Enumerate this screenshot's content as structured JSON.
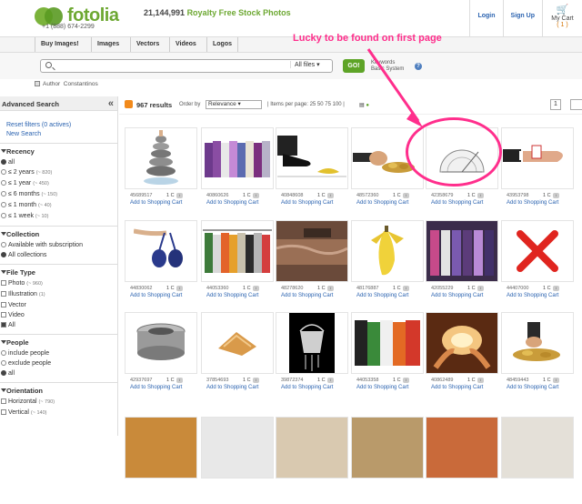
{
  "brand": {
    "name": "fotolia",
    "phone": "+1 (888) 674-2299",
    "stock_count": "21,144,991",
    "tagline": "Royalty Free Stock Photos"
  },
  "top_links": {
    "login": "Login",
    "signup": "Sign Up",
    "cart_label": "My Cart",
    "cart_count": "( 1 )"
  },
  "nav": [
    "Buy Images!",
    "Images",
    "Vectors",
    "Videos",
    "Logos"
  ],
  "search": {
    "value": "",
    "filter": "All files",
    "go": "GO!",
    "kw1": "Keywords",
    "kw2": "Basic System",
    "help": "?"
  },
  "author": {
    "label": "Author",
    "name": "Constantinos"
  },
  "sidebar": {
    "title": "Advanced Search",
    "collapse": "«",
    "reset": "Reset filters (0 actives)",
    "new_search": "New Search",
    "recency": {
      "title": "Recency",
      "options": [
        {
          "label": "all",
          "count": "",
          "checked": true
        },
        {
          "label": "≤ 2 years",
          "count": "(~ 820)",
          "checked": false
        },
        {
          "label": "≤ 1 year",
          "count": "(~ 450)",
          "checked": false
        },
        {
          "label": "≤ 6 months",
          "count": "(~ 150)",
          "checked": false
        },
        {
          "label": "≤ 1 month",
          "count": "(~ 40)",
          "checked": false
        },
        {
          "label": "≤ 1 week",
          "count": "(~ 10)",
          "checked": false
        }
      ]
    },
    "collection": {
      "title": "Collection",
      "options": [
        {
          "label": "Available with subscription",
          "checked": false
        },
        {
          "label": "All collections",
          "checked": true
        }
      ]
    },
    "file_type": {
      "title": "File Type",
      "options": [
        {
          "label": "Photo",
          "count": "(~ 960)",
          "checked": false
        },
        {
          "label": "Illustration",
          "count": "(1)",
          "checked": false
        },
        {
          "label": "Vector",
          "count": "",
          "checked": false
        },
        {
          "label": "Video",
          "count": "",
          "checked": false
        },
        {
          "label": "All",
          "count": "",
          "checked": true
        }
      ]
    },
    "people": {
      "title": "People",
      "options": [
        {
          "label": "include people",
          "checked": false
        },
        {
          "label": "exclude people",
          "checked": false
        },
        {
          "label": "all",
          "checked": true
        }
      ]
    },
    "orientation": {
      "title": "Orientation",
      "options": [
        {
          "label": "Horizontal",
          "count": "(~ 790)",
          "checked": false
        },
        {
          "label": "Vertical",
          "count": "(~ 140)",
          "checked": false
        }
      ]
    }
  },
  "results": {
    "count": "967 results",
    "order_label": "Order by",
    "order_value": "Relevance",
    "per_page": "| Items per page: 25 50 75 100 |",
    "page": "1"
  },
  "add_to_cart": "Add to Shopping Cart",
  "price": "1 C",
  "items": [
    {
      "id": "45689517",
      "icon": "stacked-stones-icon"
    },
    {
      "id": "40860626",
      "icon": "shirts-icon"
    },
    {
      "id": "40848608",
      "icon": "shoe-banana-icon"
    },
    {
      "id": "48572360",
      "icon": "hand-coins-icon"
    },
    {
      "id": "42358679",
      "icon": "protractor-icon"
    },
    {
      "id": "43953798",
      "icon": "hand-card-icon"
    },
    {
      "id": "44830062",
      "icon": "bra-hanging-icon"
    },
    {
      "id": "44053360",
      "icon": "shirts-rack-icon"
    },
    {
      "id": "48278620",
      "icon": "carpet-icon"
    },
    {
      "id": "48176887",
      "icon": "banana-icon"
    },
    {
      "id": "42055229",
      "icon": "suits-rack-icon"
    },
    {
      "id": "44407000",
      "icon": "red-x-icon"
    },
    {
      "id": "42937697",
      "icon": "bearing-icon"
    },
    {
      "id": "37854693",
      "icon": "pastry-icon"
    },
    {
      "id": "39872374",
      "icon": "bucket-icon"
    },
    {
      "id": "44053358",
      "icon": "clothes-icon"
    },
    {
      "id": "40862489",
      "icon": "glowing-hands-icon"
    },
    {
      "id": "48459443",
      "icon": "hand-coins-2-icon"
    }
  ],
  "annotation": "Lucky to be found on first page",
  "colors": {
    "brand_green": "#6da832",
    "annotation_pink": "#ff2e8c",
    "link_blue": "#2b63b0"
  }
}
